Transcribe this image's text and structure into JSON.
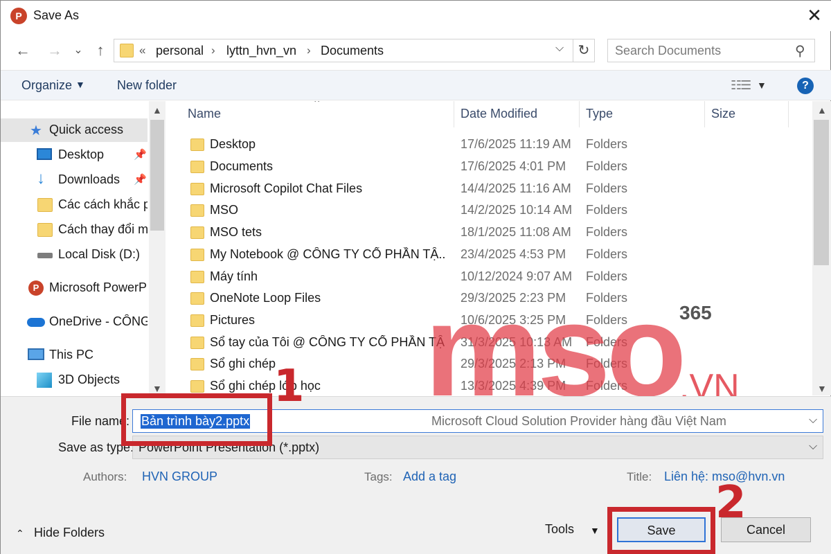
{
  "window": {
    "title": "Save As",
    "app_icon": "P",
    "close_glyph": "✕"
  },
  "nav": {
    "back": "←",
    "forward": "→",
    "recent": "⌄",
    "up": "↑",
    "address_chevron": "«",
    "breadcrumbs": [
      "personal",
      "lyttn_hvn_vn",
      "Documents"
    ],
    "search_placeholder": "Search Documents"
  },
  "toolbar": {
    "organize": "Organize",
    "new_folder": "New folder",
    "help": "?"
  },
  "sidebar": {
    "items": [
      {
        "label": "Quick access",
        "icon": "star-icon",
        "pinned": false
      },
      {
        "label": "Desktop",
        "icon": "desktop-icon",
        "pinned": true
      },
      {
        "label": "Downloads",
        "icon": "download-icon",
        "pinned": true
      },
      {
        "label": "Các cách khắc p",
        "icon": "folder-icon",
        "pinned": false
      },
      {
        "label": "Cách thay đổi m",
        "icon": "folder-icon",
        "pinned": false
      },
      {
        "label": "Local Disk (D:)",
        "icon": "disk-icon",
        "pinned": false
      },
      {
        "label": "Microsoft PowerP",
        "icon": "powerpoint-icon",
        "pinned": false
      },
      {
        "label": "OneDrive - CÔNG",
        "icon": "cloud-icon",
        "pinned": false
      },
      {
        "label": "This PC",
        "icon": "pc-icon",
        "pinned": false
      },
      {
        "label": "3D Objects",
        "icon": "cube-icon",
        "pinned": false
      }
    ]
  },
  "filelist": {
    "columns": [
      "Name",
      "Date Modified",
      "Type",
      "Size"
    ],
    "rows": [
      {
        "name": "Desktop",
        "date": "17/6/2025 11:19 AM",
        "type": "Folders"
      },
      {
        "name": "Documents",
        "date": "17/6/2025 4:01 PM",
        "type": "Folders"
      },
      {
        "name": "Microsoft Copilot Chat Files",
        "date": "14/4/2025 11:16 AM",
        "type": "Folders"
      },
      {
        "name": "MSO",
        "date": "14/2/2025 10:14 AM",
        "type": "Folders"
      },
      {
        "name": "MSO tets",
        "date": "18/1/2025 11:08 AM",
        "type": "Folders"
      },
      {
        "name": "My Notebook @ CÔNG TY CỔ PHẦN TẬ...",
        "date": "23/4/2025 4:53 PM",
        "type": "Folders"
      },
      {
        "name": "Máy tính",
        "date": "10/12/2024 9:07 AM",
        "type": "Folders"
      },
      {
        "name": "OneNote Loop Files",
        "date": "29/3/2025 2:23 PM",
        "type": "Folders"
      },
      {
        "name": "Pictures",
        "date": "10/6/2025 3:25 PM",
        "type": "Folders"
      },
      {
        "name": "Sổ tay của Tôi @ CÔNG TY CỔ PHẦN TẬ...",
        "date": "31/3/2025 10:13 AM",
        "type": "Folders"
      },
      {
        "name": "Sổ ghi chép",
        "date": "29/3/2025 2:13 PM",
        "type": "Folders"
      },
      {
        "name": "Sổ ghi chép lớp học",
        "date": "13/3/2025 4:39 PM",
        "type": "Folders"
      }
    ]
  },
  "form": {
    "file_name_label": "File name:",
    "file_name_value": "Bản trình bày2.pptx",
    "save_type_label": "Save as type:",
    "save_type_value": "PowerPoint Presentation (*.pptx)",
    "authors_label": "Authors:",
    "authors_value": "HVN GROUP",
    "tags_label": "Tags:",
    "tags_value": "Add a tag",
    "title_label": "Title:",
    "title_value": "Liên hệ: mso@hvn.vn"
  },
  "footer": {
    "hide_folders": "Hide Folders",
    "tools": "Tools",
    "save": "Save",
    "cancel": "Cancel"
  },
  "watermark": {
    "logo": "mso",
    "superscript": "365",
    "suffix": ".VN",
    "tagline": "Microsoft Cloud Solution Provider hàng đầu Việt Nam"
  },
  "annotations": {
    "step1": "1",
    "step2": "2"
  },
  "colors": {
    "accent": "#1e66d0",
    "callout": "#c9282d",
    "watermark": "#e23c46",
    "folder": "#f7d673"
  }
}
